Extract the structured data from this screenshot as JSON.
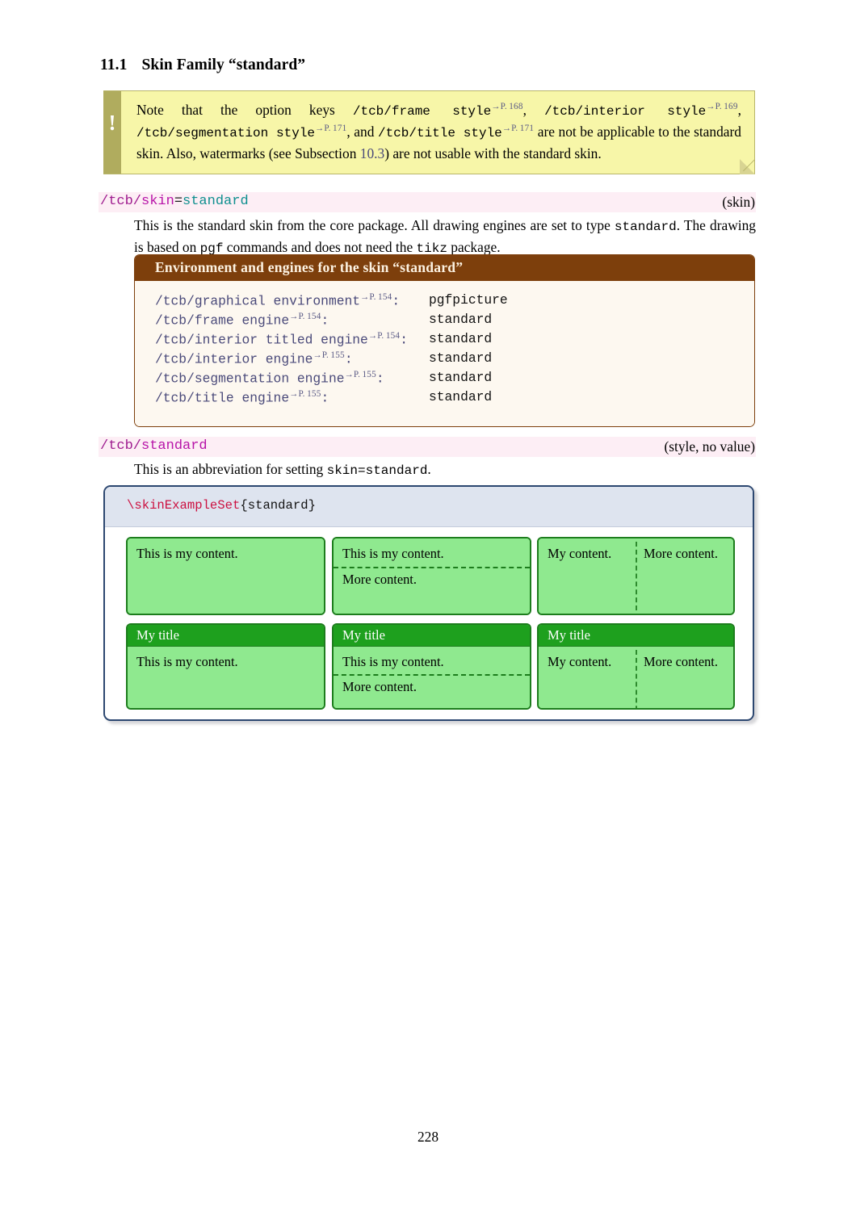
{
  "section": {
    "number": "11.1",
    "title": "Skin Family “standard”"
  },
  "note": {
    "icon": "exclamation-mark-icon",
    "bang": "!",
    "segments": [
      {
        "text": "Note that the option keys ",
        "style": "serif"
      },
      {
        "text": "/tcb/frame style",
        "style": "mono"
      },
      {
        "text": "→P. 168",
        "style": "pageref"
      },
      {
        "text": ", ",
        "style": "serif"
      },
      {
        "text": "/tcb/interior style",
        "style": "mono"
      },
      {
        "text": "→P. 169",
        "style": "pageref"
      },
      {
        "text": ", ",
        "style": "serif"
      },
      {
        "text": "/tcb/segmentation style",
        "style": "mono"
      },
      {
        "text": "→P. 171",
        "style": "pageref"
      },
      {
        "text": ", and ",
        "style": "serif"
      },
      {
        "text": "/tcb/title style",
        "style": "mono"
      },
      {
        "text": "→P. 171",
        "style": "pageref"
      },
      {
        "text": " are not be applicable to the standard skin. Also, watermarks (see Subsection ",
        "style": "serif"
      },
      {
        "text": "10.3",
        "style": "link"
      },
      {
        "text": ") are not usable with the standard skin.",
        "style": "serif"
      }
    ],
    "bg_color": "#f7f6a8",
    "strip_color": "#b0ac5e",
    "border_color": "#b8b56a"
  },
  "key_skin": {
    "prefix": "/tcb/",
    "name": "skin",
    "equals": "=",
    "value": "standard",
    "type": "(skin)",
    "bg_color": "#fdeef5",
    "description_line1": "This is the standard skin from the core package.  All drawing engines are set to type",
    "description_line2_pre": "",
    "description_mono1": "standard",
    "description_mid": ". The drawing is based on ",
    "description_mono2": "pgf",
    "description_mid2": " commands and does not need the ",
    "description_mono3": "tikz",
    "description_end": " package."
  },
  "env_box": {
    "title": "Environment and engines for the skin “standard”",
    "title_bg": "#7d3f0c",
    "interior_bg": "#fdf8f0",
    "rows": [
      {
        "key": "/tcb/graphical environment",
        "pageref": "→P. 154",
        "colon": ":",
        "value": "pgfpicture"
      },
      {
        "key": "/tcb/frame engine",
        "pageref": "→P. 154",
        "colon": ":",
        "value": "standard"
      },
      {
        "key": "/tcb/interior titled engine",
        "pageref": "→P. 154",
        "colon": ":",
        "value": "standard"
      },
      {
        "key": "/tcb/interior engine",
        "pageref": "→P. 155",
        "colon": ":",
        "value": "standard"
      },
      {
        "key": "/tcb/segmentation engine",
        "pageref": "→P. 155",
        "colon": ":",
        "value": "standard"
      },
      {
        "key": "/tcb/title engine",
        "pageref": "→P. 155",
        "colon": ":",
        "value": "standard"
      }
    ]
  },
  "key_standard": {
    "prefix": "/tcb/",
    "name": "standard",
    "type": "(style, no value)",
    "bg_color": "#fdeef5",
    "description_pre": "This is an abbreviation for setting ",
    "description_mono": "skin=standard",
    "description_post": "."
  },
  "example": {
    "code_command": "\\skinExampleSet",
    "code_arg": "{standard}",
    "header_bg": "#dee4ef",
    "border_color": "#2c4770",
    "demo_border": "#1d7d1d",
    "demo_interior": "#8fe98f",
    "demo_title_bg": "#1ea01e",
    "boxes": [
      {
        "id": "plain-simple",
        "title": null,
        "content": "This is my content.",
        "second": null,
        "layout": "plain"
      },
      {
        "id": "plain-segmented",
        "title": null,
        "content": "This is my content.",
        "second": "More content.",
        "layout": "segmented"
      },
      {
        "id": "plain-sidebyside",
        "title": null,
        "content": "My content.",
        "second": "More content.",
        "layout": "sidebyside"
      },
      {
        "id": "titled-simple",
        "title": "My title",
        "content": "This is my content.",
        "second": null,
        "layout": "plain"
      },
      {
        "id": "titled-segmented",
        "title": "My title",
        "content": "This is my content.",
        "second": "More content.",
        "layout": "segmented"
      },
      {
        "id": "titled-sidebyside",
        "title": "My title",
        "content": "My content.",
        "second": "More content.",
        "layout": "sidebyside"
      }
    ]
  },
  "page_number": "228"
}
